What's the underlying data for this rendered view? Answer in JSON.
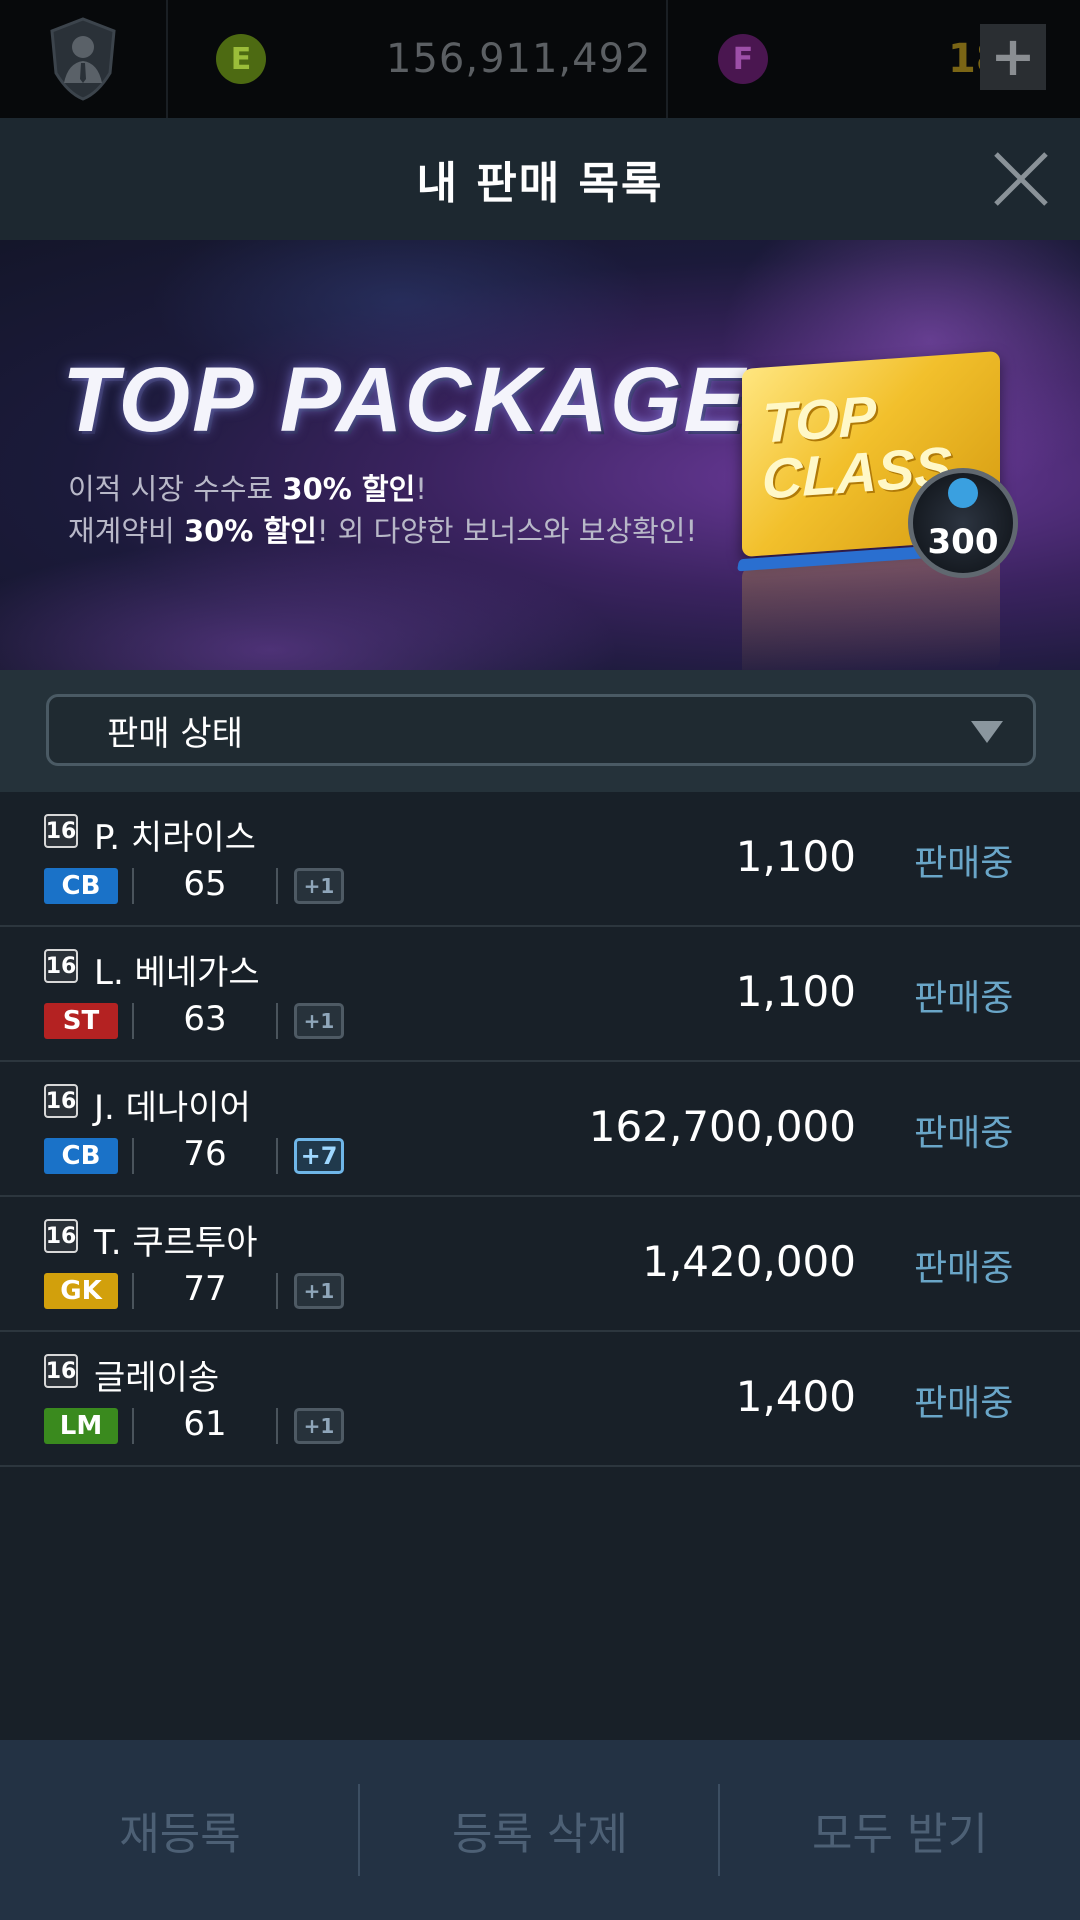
{
  "topbar": {
    "ecoin_symbol": "E",
    "ecoin_value": "156,911,492",
    "fcoin_symbol": "F",
    "fcoin_value": "18",
    "plus_label": "+"
  },
  "header": {
    "title": "내 판매 목록"
  },
  "banner": {
    "title": "TOP PACKAGE",
    "line1_pre": "이적 시장 수수료 ",
    "line1_bold": "30% 할인",
    "line1_post": "!",
    "line2_pre": "재계약비 ",
    "line2_bold": "30% 할인",
    "line2_post": "! 외 다양한 보너스와 보상확인!",
    "card_line1": "TOP",
    "card_line2": "CLASS",
    "badge_value": "300"
  },
  "filter": {
    "label": "판매 상태"
  },
  "listings": [
    {
      "season": "16",
      "name": "P. 치라이스",
      "position": "CB",
      "position_color": "#1a72c8",
      "ovr": "65",
      "upgrade": "+1",
      "price": "1,100",
      "status": "판매중"
    },
    {
      "season": "16",
      "name": "L. 베네가스",
      "position": "ST",
      "position_color": "#b42222",
      "ovr": "63",
      "upgrade": "+1",
      "price": "1,100",
      "status": "판매중"
    },
    {
      "season": "16",
      "name": "J. 데나이어",
      "position": "CB",
      "position_color": "#1a72c8",
      "ovr": "76",
      "upgrade": "+7",
      "price": "162,700,000",
      "status": "판매중"
    },
    {
      "season": "16",
      "name": "T. 쿠르투아",
      "position": "GK",
      "position_color": "#d2a00c",
      "ovr": "77",
      "upgrade": "+1",
      "price": "1,420,000",
      "status": "판매중"
    },
    {
      "season": "16",
      "name": "글레이송",
      "position": "LM",
      "position_color": "#3a8a1e",
      "ovr": "61",
      "upgrade": "+1",
      "price": "1,400",
      "status": "판매중"
    }
  ],
  "bottom": {
    "relist": "재등록",
    "delete": "등록 삭제",
    "receive_all": "모두 받기"
  }
}
